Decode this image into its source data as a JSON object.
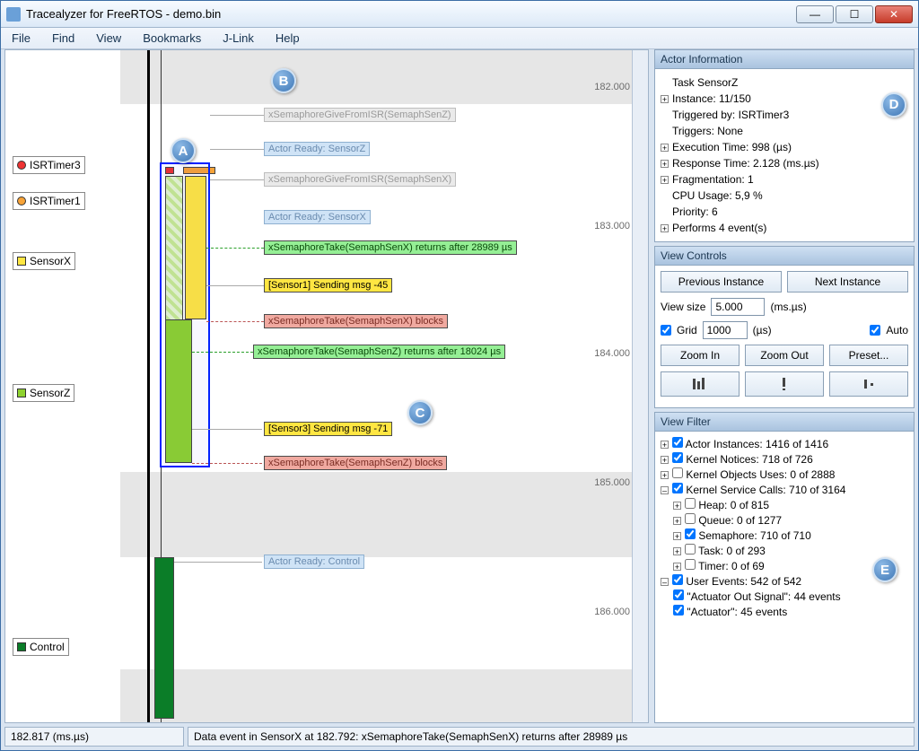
{
  "window": {
    "title": "Tracealyzer for FreeRTOS - demo.bin",
    "min": "—",
    "max": "☐",
    "close": "✕"
  },
  "menu": {
    "file": "File",
    "find": "Find",
    "view": "View",
    "bookmarks": "Bookmarks",
    "jlink": "J-Link",
    "help": "Help"
  },
  "legend": {
    "isrtimer3": "ISRTimer3",
    "isrtimer1": "ISRTimer1",
    "sensorx": "SensorX",
    "sensorz": "SensorZ",
    "control": "Control"
  },
  "ticks": {
    "t1": "182.000",
    "t2": "183.000",
    "t3": "184.000",
    "t4": "185.000",
    "t5": "186.000"
  },
  "events": {
    "e1": "xSemaphoreGiveFromISR(SemaphSenZ)",
    "e2": "Actor Ready: SensorZ",
    "e3": "xSemaphoreGiveFromISR(SemaphSenX)",
    "e4": "Actor Ready: SensorX",
    "e5": "xSemaphoreTake(SemaphSenX) returns after 28989 µs",
    "e6": "[Sensor1] Sending msg -45",
    "e7": "xSemaphoreTake(SemaphSenX) blocks",
    "e8": "xSemaphoreTake(SemaphSenZ) returns after 18024 µs",
    "e9": "[Sensor3] Sending msg -71",
    "e10": "xSemaphoreTake(SemaphSenZ) blocks",
    "e11": "Actor Ready: Control"
  },
  "callouts": {
    "a": "A",
    "b": "B",
    "c": "C",
    "d": "D",
    "e": "E"
  },
  "actorinfo": {
    "header": "Actor Information",
    "l1": "Task SensorZ",
    "l2": "Instance: 11/150",
    "l3": "Triggered by: ISRTimer3",
    "l4": "Triggers: None",
    "l5": "Execution Time: 998 (µs)",
    "l6": "Response Time: 2.128 (ms.µs)",
    "l7": "Fragmentation: 1",
    "l8": "CPU Usage: 5,9 %",
    "l9": "Priority: 6",
    "l10": "Performs 4 event(s)"
  },
  "viewctl": {
    "header": "View Controls",
    "prev": "Previous Instance",
    "next": "Next Instance",
    "vsize_lbl": "View size",
    "vsize_val": "5.000",
    "vsize_unit": "(ms.µs)",
    "grid_lbl": "Grid",
    "grid_val": "1000",
    "grid_unit": "(µs)",
    "auto": "Auto",
    "zin": "Zoom In",
    "zout": "Zoom Out",
    "preset": "Preset..."
  },
  "filter": {
    "header": "View Filter",
    "l1": "Actor Instances: 1416 of 1416",
    "l2": "Kernel Notices: 718 of 726",
    "l3": "Kernel Objects Uses: 0 of 2888",
    "l4": "Kernel Service Calls: 710 of 3164",
    "l4a": "Heap: 0 of 815",
    "l4b": "Queue: 0 of 1277",
    "l4c": "Semaphore: 710 of 710",
    "l4d": "Task: 0 of 293",
    "l4e": "Timer: 0 of 69",
    "l5": "User Events: 542 of 542",
    "l5a": "\"Actuator Out Signal\": 44 events",
    "l5b": "\"Actuator\": 45 events"
  },
  "status": {
    "s1": "182.817 (ms.µs)",
    "s2": "Data event in SensorX at 182.792: xSemaphoreTake(SemaphSenX) returns after 28989 µs"
  }
}
